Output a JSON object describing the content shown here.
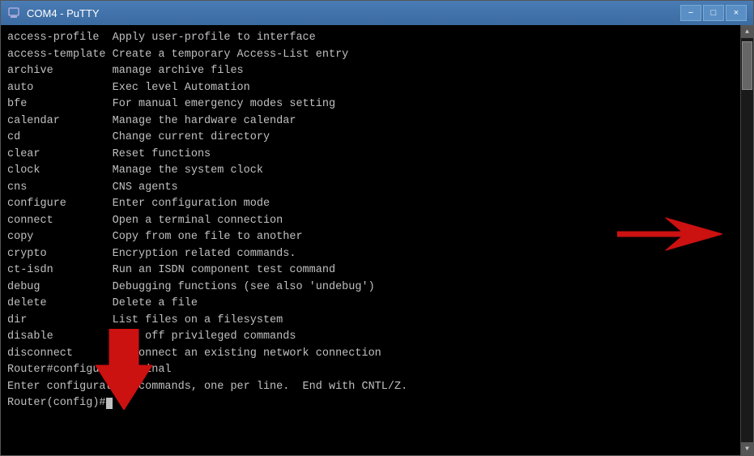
{
  "window": {
    "title": "COM4 - PuTTY",
    "icon": "monitor-icon",
    "minimize_label": "−",
    "maximize_label": "□",
    "close_label": "×"
  },
  "terminal": {
    "commands": [
      {
        "cmd": "access-profile",
        "desc": "Apply user-profile to interface"
      },
      {
        "cmd": "access-template",
        "desc": "Create a temporary Access-List entry"
      },
      {
        "cmd": "archive",
        "desc": "manage archive files"
      },
      {
        "cmd": "auto",
        "desc": "Exec level Automation"
      },
      {
        "cmd": "bfe",
        "desc": "For manual emergency modes setting"
      },
      {
        "cmd": "calendar",
        "desc": "Manage the hardware calendar"
      },
      {
        "cmd": "cd",
        "desc": "Change current directory"
      },
      {
        "cmd": "clear",
        "desc": "Reset functions"
      },
      {
        "cmd": "clock",
        "desc": "Manage the system clock"
      },
      {
        "cmd": "cns",
        "desc": "CNS agents"
      },
      {
        "cmd": "configure",
        "desc": "Enter configuration mode"
      },
      {
        "cmd": "connect",
        "desc": "Open a terminal connection"
      },
      {
        "cmd": "copy",
        "desc": "Copy from one file to another"
      },
      {
        "cmd": "crypto",
        "desc": "Encryption related commands."
      },
      {
        "cmd": "ct-isdn",
        "desc": "Run an ISDN component test command"
      },
      {
        "cmd": "debug",
        "desc": "Debugging functions (see also 'undebug')"
      },
      {
        "cmd": "delete",
        "desc": "Delete a file"
      },
      {
        "cmd": "dir",
        "desc": "List files on a filesystem"
      },
      {
        "cmd": "disable",
        "desc": "Turn off privileged commands"
      },
      {
        "cmd": "disconnect",
        "desc": "Disconnect an existing network connection"
      }
    ],
    "prompt_lines": [
      "Router#configure terminal",
      "Enter configuration commands, one per line.  End with CNTL/Z.",
      "Router(config)#"
    ]
  }
}
